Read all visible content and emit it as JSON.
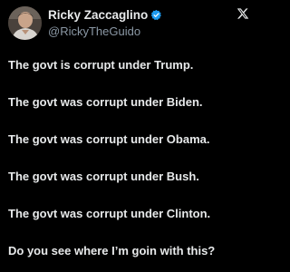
{
  "author": {
    "display_name": "Ricky Zaccaglino",
    "handle": "@RickyTheGuido",
    "verified": true,
    "verified_color": "#1d9bf0",
    "avatar_icon": "profile-photo",
    "platform_icon": "x-logo-icon"
  },
  "tweet": {
    "lines": [
      "The govt is corrupt under Trump.",
      "The govt was corrupt under Biden.",
      "The govt was corrupt under Obama.",
      "The govt was corrupt under Bush.",
      "The govt was corrupt under Clinton.",
      "Do you see where I’m goin with this?"
    ]
  },
  "colors": {
    "background": "#000000",
    "text_primary": "#e7e9ea",
    "text_secondary": "#8b98a5",
    "accent": "#1d9bf0"
  }
}
